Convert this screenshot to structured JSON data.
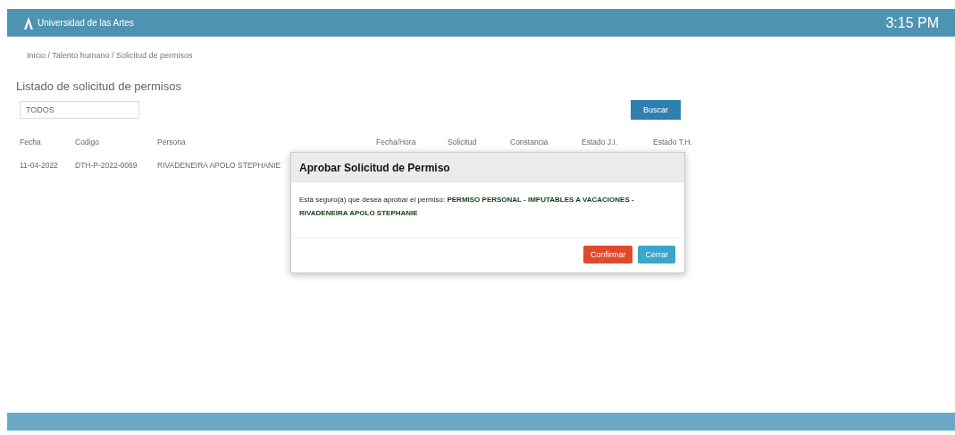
{
  "header": {
    "brand": "Universidad de las Artes",
    "time": "3:15 PM"
  },
  "breadcrumb": "Inicio / Talento humano / Solicitud de permisos",
  "page_title": "Listado de solicitud de permisos",
  "filter": {
    "value": "TODOS"
  },
  "search_button": "Buscar",
  "table": {
    "columns": [
      "Fecha",
      "Codigo",
      "Persona",
      "Fecha/Hora",
      "Solicitud",
      "Constancia",
      "Estado J.I.",
      "Estado T.H."
    ],
    "rows": [
      {
        "cells": [
          "11-04-2022",
          "DTH-P-2022-0069",
          "RIVADENEIRA APOLO STEPHANIE"
        ]
      }
    ]
  },
  "modal": {
    "title": "Aprobar Solicitud de Permiso",
    "message": "Está seguro(a) que desea aprobar el permiso: **PERMISO PERSONAL - IMPUTABLES A VACACIONES - RIVADENEIRA APOLO STEPHANIE**",
    "buttons": [
      {
        "label": "Confirmar",
        "kind": "danger"
      },
      {
        "label": "Cerrar",
        "kind": "info"
      }
    ]
  }
}
